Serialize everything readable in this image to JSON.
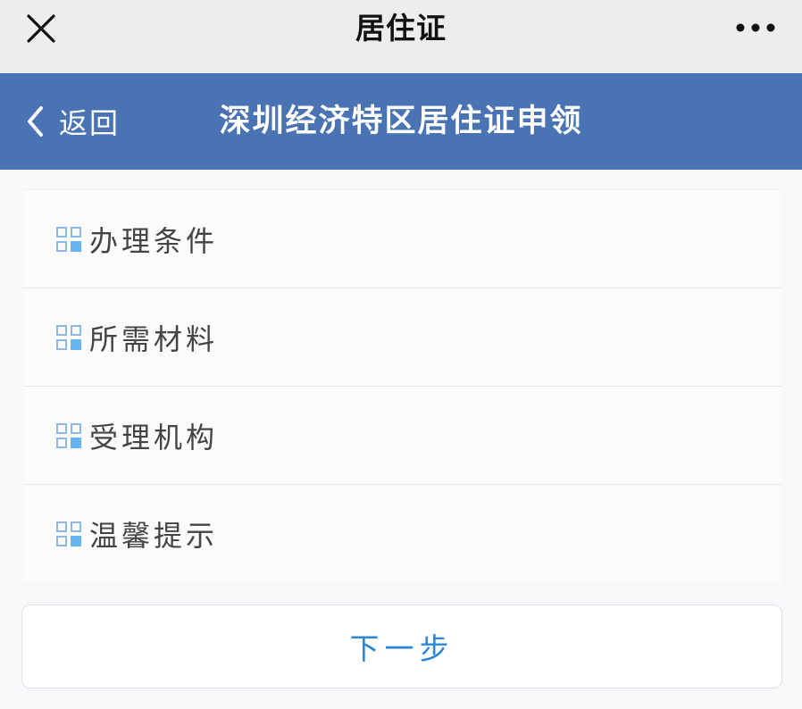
{
  "window": {
    "title": "居住证",
    "close_icon": "close-icon",
    "more_icon": "more-icon"
  },
  "header": {
    "back_label": "返回",
    "title": "深圳经济特区居住证申领",
    "background_color": "#4a73b3",
    "back_icon": "chevron-left-icon"
  },
  "menu": {
    "items": [
      {
        "label": "办理条件",
        "icon": "grid-icon"
      },
      {
        "label": "所需材料",
        "icon": "grid-icon"
      },
      {
        "label": "受理机构",
        "icon": "grid-icon"
      },
      {
        "label": "温馨提示",
        "icon": "grid-icon"
      }
    ]
  },
  "actions": {
    "next_label": "下一步",
    "next_color": "#2d87d8"
  }
}
